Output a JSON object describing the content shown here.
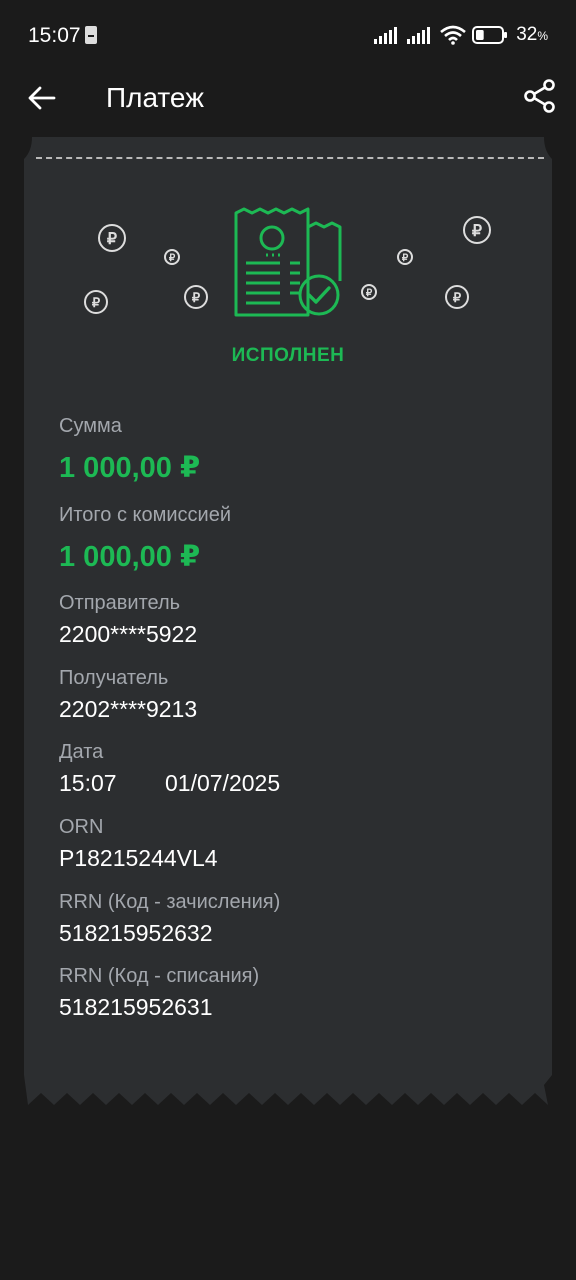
{
  "status_bar": {
    "time": "15:07",
    "battery_percent": "32",
    "battery_unit": "%",
    "battery_level": 0.32
  },
  "header": {
    "title": "Платеж",
    "back_icon": "arrow-left-icon",
    "share_icon": "share-icon"
  },
  "receipt": {
    "status": "ИСПОЛНЕН",
    "status_color": "#1db954",
    "fields": {
      "amount": {
        "label": "Сумма",
        "value": "1 000,00 ₽"
      },
      "total": {
        "label": "Итого с комиссией",
        "value": "1 000,00 ₽"
      },
      "sender": {
        "label": "Отправитель",
        "value": "2200****5922"
      },
      "recipient": {
        "label": "Получатель",
        "value": "2202****9213"
      },
      "date": {
        "label": "Дата",
        "time": "15:07",
        "date": "01/07/2025"
      },
      "orn": {
        "label": "ORN",
        "value": "P18215244VL4"
      },
      "rrn_credit": {
        "label": "RRN (Код - зачисления)",
        "value": "518215952632"
      },
      "rrn_debit": {
        "label": "RRN (Код - списания)",
        "value": "518215952631"
      }
    }
  },
  "colors": {
    "background": "#1b1b1b",
    "card": "#2c2e30",
    "accent": "#1db954",
    "label": "#a3a7ad"
  }
}
